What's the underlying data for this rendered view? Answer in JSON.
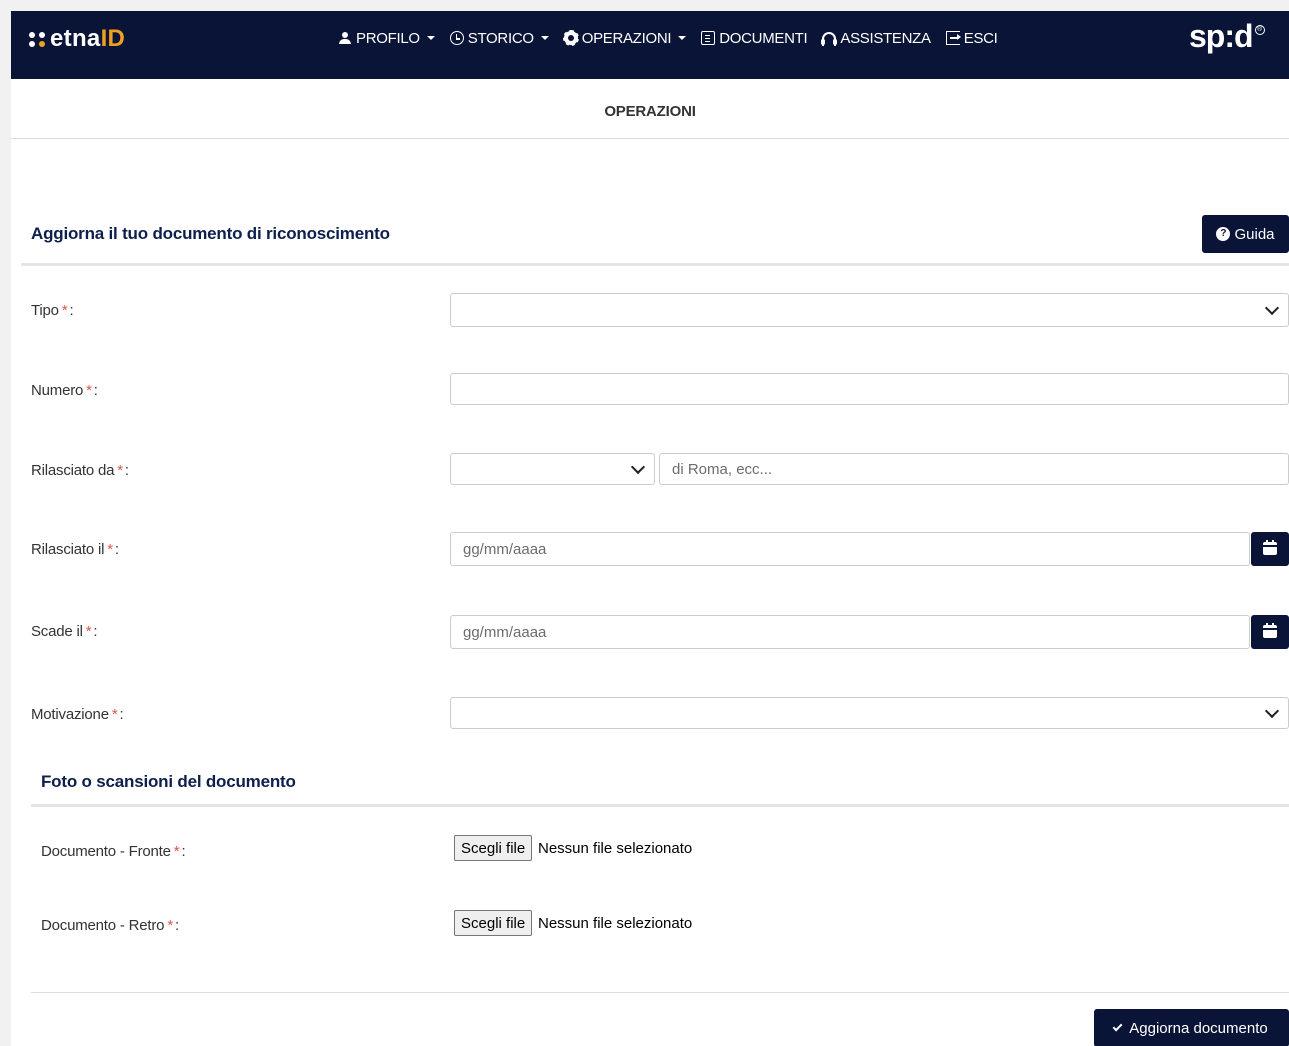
{
  "brand": {
    "prefix": "etna",
    "highlight": "ID"
  },
  "nav": {
    "items": [
      {
        "label": "PROFILO",
        "icon": "user-icon",
        "dropdown": true
      },
      {
        "label": "STORICO",
        "icon": "clock-icon",
        "dropdown": true
      },
      {
        "label": "OPERAZIONI",
        "icon": "gear-icon",
        "dropdown": true
      },
      {
        "label": "DOCUMENTI",
        "icon": "documents-icon",
        "dropdown": false
      },
      {
        "label": "ASSISTENZA",
        "icon": "headset-icon",
        "dropdown": false
      },
      {
        "label": "ESCI",
        "icon": "logout-icon",
        "dropdown": false
      }
    ]
  },
  "spid_logo": "sp:d",
  "spid_mark": "®",
  "page_title": "OPERAZIONI",
  "form": {
    "title": "Aggiorna il tuo documento di riconoscimento",
    "guide_button": "Guida",
    "required_marker": "*",
    "colon": ":",
    "fields": {
      "tipo": {
        "label": "Tipo",
        "value": ""
      },
      "numero": {
        "label": "Numero",
        "value": ""
      },
      "rilasciato_da": {
        "label": "Rilasciato da",
        "select_value": "",
        "placeholder": "di Roma, ecc..."
      },
      "rilasciato_il": {
        "label": "Rilasciato il",
        "placeholder": "gg/mm/aaaa"
      },
      "scade_il": {
        "label": "Scade il",
        "placeholder": "gg/mm/aaaa"
      },
      "motivazione": {
        "label": "Motivazione",
        "value": ""
      }
    },
    "scans": {
      "title": "Foto o scansioni del documento",
      "front": {
        "label": "Documento - Fronte",
        "button": "Scegli file",
        "status": "Nessun file selezionato"
      },
      "back": {
        "label": "Documento - Retro",
        "button": "Scegli file",
        "status": "Nessun file selezionato"
      }
    },
    "submit_button": "Aggiorna documento"
  },
  "colors": {
    "navy": "#091437",
    "accent": "#f0a020",
    "required": "#e0534b",
    "heading": "#0d1f4c"
  }
}
